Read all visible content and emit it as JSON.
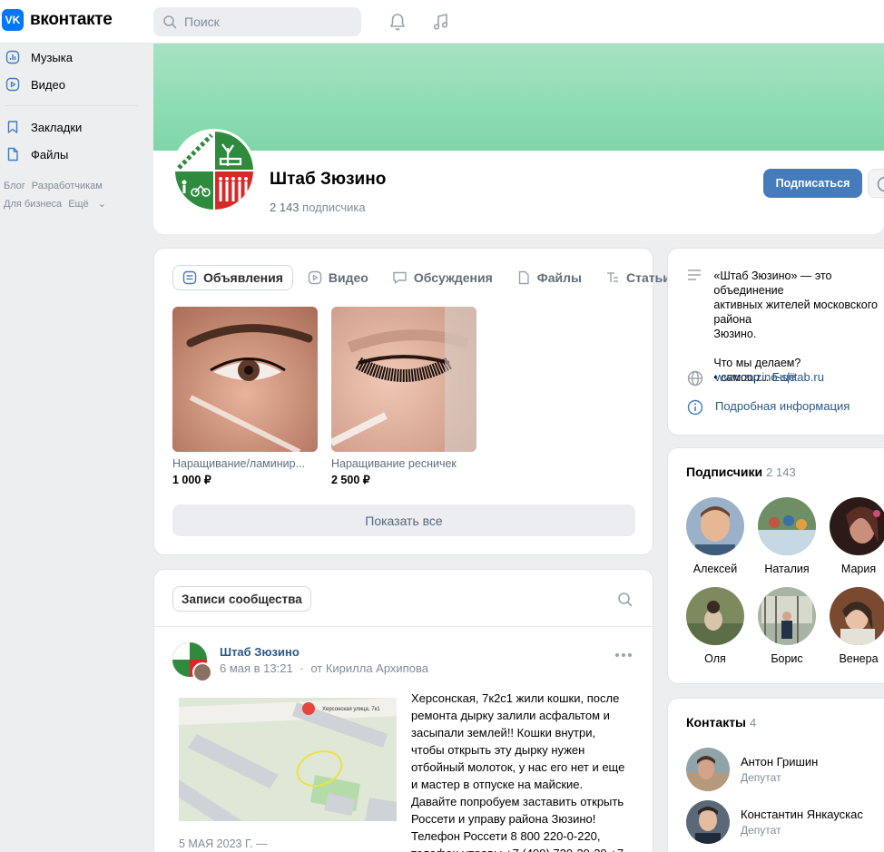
{
  "header": {
    "logo_text": "вконтакте",
    "logo_mark": "VK",
    "search_placeholder": "Поиск"
  },
  "leftnav": {
    "items": [
      {
        "label": "Музыка",
        "icon": "music-icon"
      },
      {
        "label": "Видео",
        "icon": "video-icon"
      },
      {
        "label": "Закладки",
        "icon": "bookmark-icon"
      },
      {
        "label": "Файлы",
        "icon": "file-icon"
      }
    ],
    "footer": [
      "Блог",
      "Разработчикам",
      "Для бизнеса",
      "Ещё"
    ]
  },
  "group": {
    "name": "Штаб Зюзино",
    "subscribers_count": "2 143",
    "subscribers_label": "подписчика",
    "subscribe_button": "Подписаться"
  },
  "tabs": [
    {
      "label": "Объявления",
      "icon": "market-icon"
    },
    {
      "label": "Видео",
      "icon": "video-icon"
    },
    {
      "label": "Обсуждения",
      "icon": "discussion-icon"
    },
    {
      "label": "Файлы",
      "icon": "file-icon"
    },
    {
      "label": "Статьи",
      "icon": "article-icon"
    }
  ],
  "products": [
    {
      "name": "Наращивание/ламинир...",
      "price": "1 000 ₽"
    },
    {
      "name": "Наращивание ресничек",
      "price": "2 500 ₽"
    }
  ],
  "show_all": "Показать все",
  "wall": {
    "tab": "Записи сообщества",
    "post": {
      "author": "Штаб Зюзино",
      "date": "6 мая в 13:21",
      "separator": "·",
      "by": "от Кирилла Архипова",
      "map_street": "Херсонская улица, 7к1",
      "attachment_date": "5 МАЯ 2023 Г. —",
      "text_lines": [
        "Херсонская, 7к2с1 жили кошки, после",
        "ремонта дырку залили асфальтом и",
        "засыпали землей!! Кошки внутри,",
        "чтобы открыть эту дырку нужен",
        "отбойный молоток, у нас его нет и еще",
        "и мастер в отпуске на майские.",
        "Давайте попробуем заставить открыть",
        "Россети и управу района Зюзино!",
        "Телефон Россети 8 800 220-0-220,",
        "телефон управы +7 (499) 720-29-20 +7"
      ]
    }
  },
  "about": {
    "line1": "«Штаб Зюзино» — это объединение",
    "line2": "активных жителей московского района",
    "line3": "Зюзино.",
    "line4": "Что мы делаем?",
    "line5": "• самоор...",
    "more": "Ещё",
    "website": "www.zuzino-shtab.ru",
    "details": "Подробная информация"
  },
  "subscribers": {
    "title": "Подписчики",
    "count": "2 143",
    "people": [
      "Алексей",
      "Наталия",
      "Мария",
      "Оля",
      "Борис",
      "Венера"
    ]
  },
  "contacts": {
    "title": "Контакты",
    "count": "4",
    "people": [
      {
        "name": "Антон Гришин",
        "role": "Депутат"
      },
      {
        "name": "Константин Янкаускас",
        "role": "Депутат"
      }
    ]
  },
  "colors": {
    "accent": "#447bba",
    "link": "#2a5885",
    "brand": "#0077ff",
    "cover": "#8ddcb2",
    "logo_green": "#2e8b3e",
    "logo_red": "#d8282a"
  }
}
